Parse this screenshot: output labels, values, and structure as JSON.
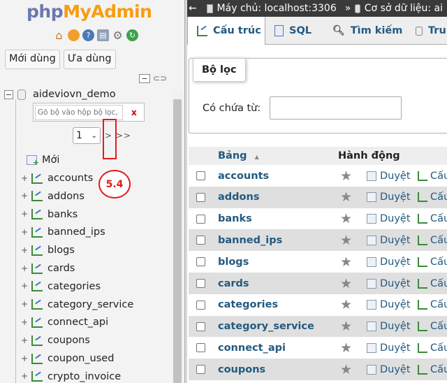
{
  "left": {
    "logo_php": "php",
    "logo_myadmin": "MyAdmin",
    "icons": [
      "home-icon",
      "exit-icon",
      "help-icon",
      "docs-icon",
      "settings-icon",
      "reload-icon"
    ],
    "recent_button": "Mới dùng",
    "favorite_button": "Ưa dùng",
    "database": "aideviovn_demo",
    "filter_placeholder": "Gõ bộ vào hộp bộ lọc, En",
    "filter_clear": "x",
    "page_select": "1",
    "page_nav": "> >>",
    "annotation": "5.4",
    "new_item": "Mới",
    "tables": [
      "accounts",
      "addons",
      "banks",
      "banned_ips",
      "blogs",
      "cards",
      "categories",
      "category_service",
      "connect_api",
      "coupons",
      "coupon_used",
      "crypto_invoice"
    ]
  },
  "right": {
    "breadcrumb": {
      "back_arrow": "←",
      "server_label": "Máy chủ: localhost:3306",
      "separator": "»",
      "db_label": "Cơ sở dữ liệu: ai"
    },
    "tabs": [
      {
        "label": "Cấu trúc",
        "icon": "structure-icon"
      },
      {
        "label": "SQL",
        "icon": "sql-icon"
      },
      {
        "label": "Tìm kiếm",
        "icon": "search-icon"
      },
      {
        "label": "Tru",
        "icon": "query-icon"
      }
    ],
    "filter": {
      "legend": "Bộ lọc",
      "contains_label": "Có chứa từ:",
      "contains_value": ""
    },
    "table_headers": {
      "name": "Bảng",
      "sort_arrow": "▲",
      "action": "Hành động"
    },
    "rows": [
      "accounts",
      "addons",
      "banks",
      "banned_ips",
      "blogs",
      "cards",
      "categories",
      "category_service",
      "connect_api",
      "coupons"
    ],
    "browse_label": "Duyệt",
    "structure_label": "Cấu"
  }
}
